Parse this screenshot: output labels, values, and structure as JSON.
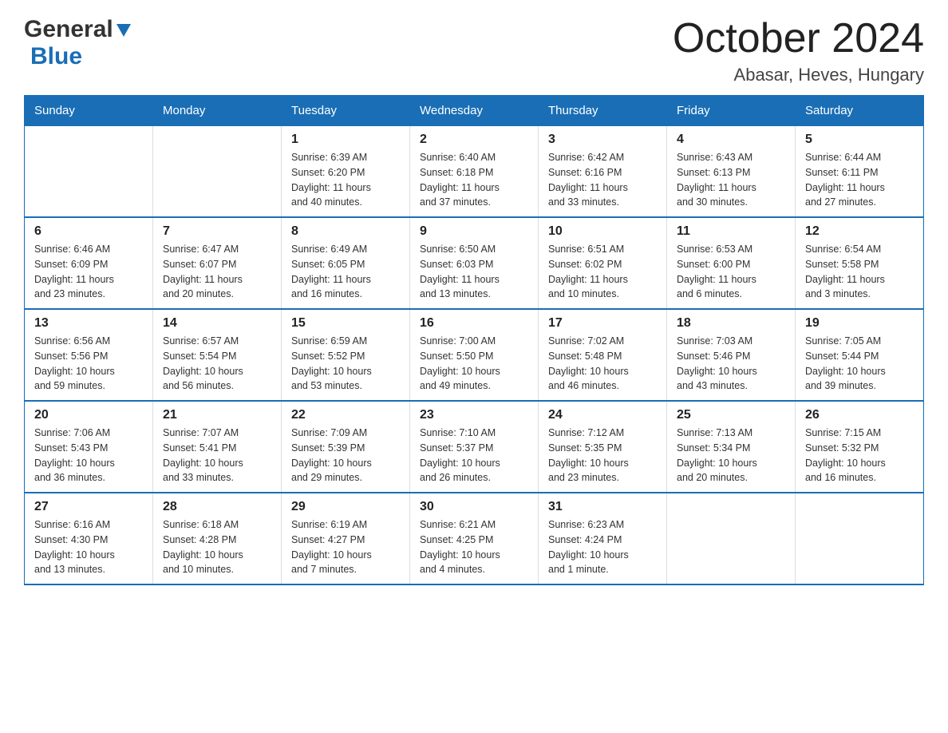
{
  "header": {
    "title": "October 2024",
    "subtitle": "Abasar, Heves, Hungary",
    "logo_general": "General",
    "logo_blue": "Blue"
  },
  "days_of_week": [
    "Sunday",
    "Monday",
    "Tuesday",
    "Wednesday",
    "Thursday",
    "Friday",
    "Saturday"
  ],
  "weeks": [
    [
      {
        "day": "",
        "info": ""
      },
      {
        "day": "",
        "info": ""
      },
      {
        "day": "1",
        "info": "Sunrise: 6:39 AM\nSunset: 6:20 PM\nDaylight: 11 hours\nand 40 minutes."
      },
      {
        "day": "2",
        "info": "Sunrise: 6:40 AM\nSunset: 6:18 PM\nDaylight: 11 hours\nand 37 minutes."
      },
      {
        "day": "3",
        "info": "Sunrise: 6:42 AM\nSunset: 6:16 PM\nDaylight: 11 hours\nand 33 minutes."
      },
      {
        "day": "4",
        "info": "Sunrise: 6:43 AM\nSunset: 6:13 PM\nDaylight: 11 hours\nand 30 minutes."
      },
      {
        "day": "5",
        "info": "Sunrise: 6:44 AM\nSunset: 6:11 PM\nDaylight: 11 hours\nand 27 minutes."
      }
    ],
    [
      {
        "day": "6",
        "info": "Sunrise: 6:46 AM\nSunset: 6:09 PM\nDaylight: 11 hours\nand 23 minutes."
      },
      {
        "day": "7",
        "info": "Sunrise: 6:47 AM\nSunset: 6:07 PM\nDaylight: 11 hours\nand 20 minutes."
      },
      {
        "day": "8",
        "info": "Sunrise: 6:49 AM\nSunset: 6:05 PM\nDaylight: 11 hours\nand 16 minutes."
      },
      {
        "day": "9",
        "info": "Sunrise: 6:50 AM\nSunset: 6:03 PM\nDaylight: 11 hours\nand 13 minutes."
      },
      {
        "day": "10",
        "info": "Sunrise: 6:51 AM\nSunset: 6:02 PM\nDaylight: 11 hours\nand 10 minutes."
      },
      {
        "day": "11",
        "info": "Sunrise: 6:53 AM\nSunset: 6:00 PM\nDaylight: 11 hours\nand 6 minutes."
      },
      {
        "day": "12",
        "info": "Sunrise: 6:54 AM\nSunset: 5:58 PM\nDaylight: 11 hours\nand 3 minutes."
      }
    ],
    [
      {
        "day": "13",
        "info": "Sunrise: 6:56 AM\nSunset: 5:56 PM\nDaylight: 10 hours\nand 59 minutes."
      },
      {
        "day": "14",
        "info": "Sunrise: 6:57 AM\nSunset: 5:54 PM\nDaylight: 10 hours\nand 56 minutes."
      },
      {
        "day": "15",
        "info": "Sunrise: 6:59 AM\nSunset: 5:52 PM\nDaylight: 10 hours\nand 53 minutes."
      },
      {
        "day": "16",
        "info": "Sunrise: 7:00 AM\nSunset: 5:50 PM\nDaylight: 10 hours\nand 49 minutes."
      },
      {
        "day": "17",
        "info": "Sunrise: 7:02 AM\nSunset: 5:48 PM\nDaylight: 10 hours\nand 46 minutes."
      },
      {
        "day": "18",
        "info": "Sunrise: 7:03 AM\nSunset: 5:46 PM\nDaylight: 10 hours\nand 43 minutes."
      },
      {
        "day": "19",
        "info": "Sunrise: 7:05 AM\nSunset: 5:44 PM\nDaylight: 10 hours\nand 39 minutes."
      }
    ],
    [
      {
        "day": "20",
        "info": "Sunrise: 7:06 AM\nSunset: 5:43 PM\nDaylight: 10 hours\nand 36 minutes."
      },
      {
        "day": "21",
        "info": "Sunrise: 7:07 AM\nSunset: 5:41 PM\nDaylight: 10 hours\nand 33 minutes."
      },
      {
        "day": "22",
        "info": "Sunrise: 7:09 AM\nSunset: 5:39 PM\nDaylight: 10 hours\nand 29 minutes."
      },
      {
        "day": "23",
        "info": "Sunrise: 7:10 AM\nSunset: 5:37 PM\nDaylight: 10 hours\nand 26 minutes."
      },
      {
        "day": "24",
        "info": "Sunrise: 7:12 AM\nSunset: 5:35 PM\nDaylight: 10 hours\nand 23 minutes."
      },
      {
        "day": "25",
        "info": "Sunrise: 7:13 AM\nSunset: 5:34 PM\nDaylight: 10 hours\nand 20 minutes."
      },
      {
        "day": "26",
        "info": "Sunrise: 7:15 AM\nSunset: 5:32 PM\nDaylight: 10 hours\nand 16 minutes."
      }
    ],
    [
      {
        "day": "27",
        "info": "Sunrise: 6:16 AM\nSunset: 4:30 PM\nDaylight: 10 hours\nand 13 minutes."
      },
      {
        "day": "28",
        "info": "Sunrise: 6:18 AM\nSunset: 4:28 PM\nDaylight: 10 hours\nand 10 minutes."
      },
      {
        "day": "29",
        "info": "Sunrise: 6:19 AM\nSunset: 4:27 PM\nDaylight: 10 hours\nand 7 minutes."
      },
      {
        "day": "30",
        "info": "Sunrise: 6:21 AM\nSunset: 4:25 PM\nDaylight: 10 hours\nand 4 minutes."
      },
      {
        "day": "31",
        "info": "Sunrise: 6:23 AM\nSunset: 4:24 PM\nDaylight: 10 hours\nand 1 minute."
      },
      {
        "day": "",
        "info": ""
      },
      {
        "day": "",
        "info": ""
      }
    ]
  ]
}
